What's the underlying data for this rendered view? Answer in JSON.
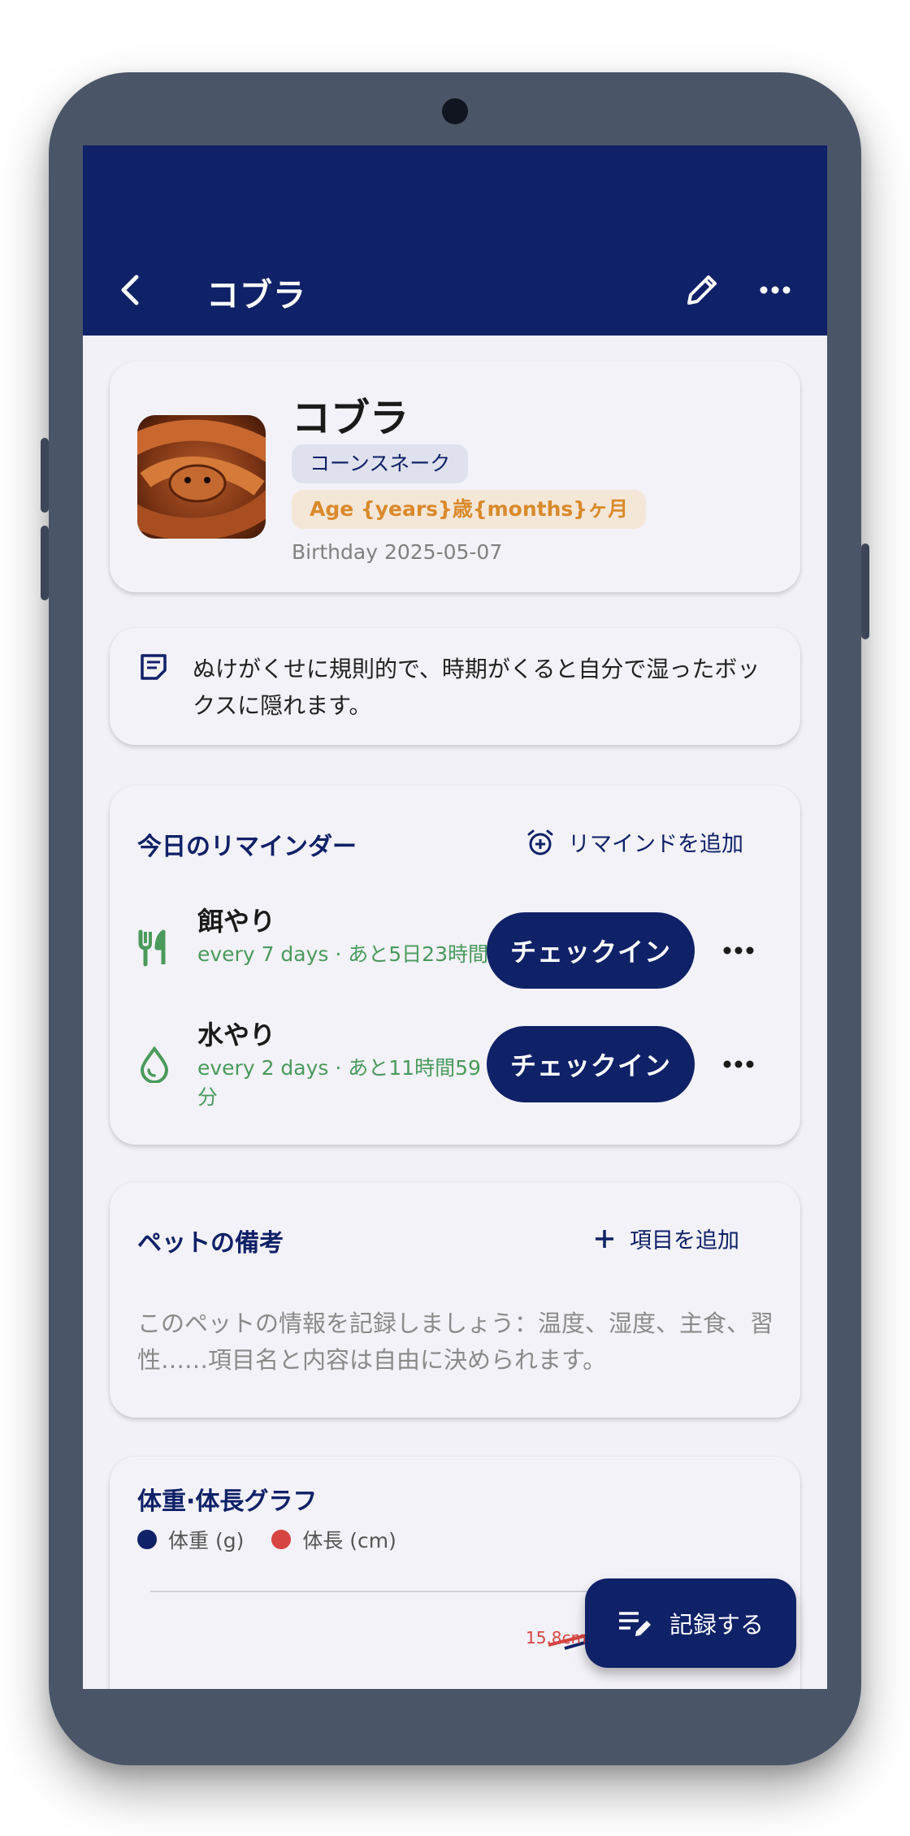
{
  "appbar": {
    "title": "コブラ"
  },
  "pet": {
    "name": "コブラ",
    "species": "コーンスネーク",
    "age": "Age {years}歳{months}ヶ月",
    "birthday": "Birthday 2025-05-07"
  },
  "note": {
    "text": "ぬけがくせに規則的で、時期がくると自分で湿ったボックスに隠れます。"
  },
  "reminders": {
    "title": "今日のリマインダー",
    "add_label": "リマインドを追加",
    "items": [
      {
        "name": "餌やり",
        "schedule": "every 7 days · あと5日23時間",
        "button": "チェックイン",
        "icon": "fork-knife-icon"
      },
      {
        "name": "水やり",
        "schedule": "every 2 days · あと11時間59分",
        "button": "チェックイン",
        "icon": "water-drop-icon"
      }
    ]
  },
  "pet_notes": {
    "title": "ペットの備考",
    "add_label": "項目を追加",
    "placeholder": "このペットの情報を記録しましょう：温度、湿度、主食、習性……項目名と内容は自由に決められます。"
  },
  "chart": {
    "title": "体重·体長グラフ",
    "legend": [
      {
        "name": "体重 (g)",
        "color": "#0f2167"
      },
      {
        "name": "体長 (cm)",
        "color": "#d64541"
      }
    ],
    "data_label": "15.8cm"
  },
  "fab": {
    "label": "記録する"
  },
  "colors": {
    "primary": "#0f2167",
    "green": "#4a9a5c",
    "orange": "#d98a2b",
    "red": "#d64541"
  }
}
